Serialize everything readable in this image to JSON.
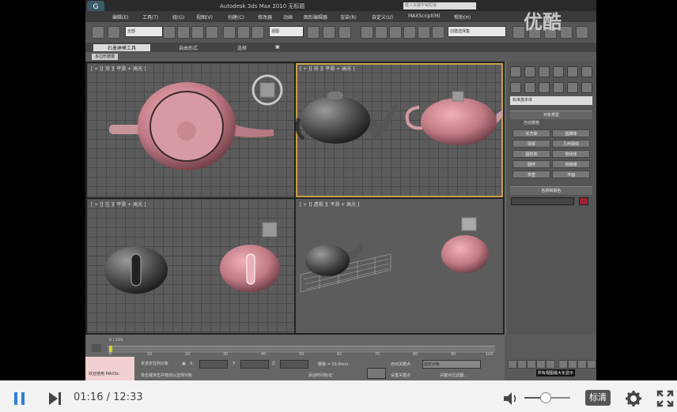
{
  "player": {
    "current_time": "01:16",
    "separator": "/",
    "duration": "12:33",
    "progress_fraction": 0.101,
    "volume_fraction": 0.45,
    "quality_label": "标清",
    "watermark_text": "优酷"
  },
  "app": {
    "title": "Autodesk 3ds Max 2010   无标题",
    "search_placeholder": "键入关键字或短语",
    "menus": [
      "编辑(E)",
      "工具(T)",
      "组(G)",
      "视图(V)",
      "创建(C)",
      "修改器",
      "动画",
      "图形编辑器",
      "渲染(R)",
      "自定义(U)",
      "MAXScript(M)",
      "帮助(H)"
    ],
    "toolbar_select_all": "全部",
    "toolbar_select_view": "视图",
    "toolbar_select_named": "创建选择集",
    "ribbon_tabs": [
      "石墨建模工具",
      "自由形式",
      "选择",
      "▣"
    ],
    "ribbon_chip": "多边形建模",
    "viewports": [
      {
        "label": "[ + ][ 顶 ][ 平滑 + 高光 ]"
      },
      {
        "label": "[ + ][ 前 ][ 平滑 + 高光 ]"
      },
      {
        "label": "[ + ][ 左 ][ 平滑 + 高光 ]"
      },
      {
        "label": "[ + ][ 透视 ][ 平滑 + 高光 ]"
      }
    ],
    "command_panel": {
      "dropdown": "标准基本体",
      "section_object_type": "对象类型",
      "autogrid": "自动栅格",
      "buttons": [
        "长方体",
        "圆锥体",
        "球体",
        "几何球体",
        "圆柱体",
        "管状体",
        "圆环",
        "四棱锥",
        "茶壶",
        "平面"
      ],
      "section_name_color": "名称和颜色"
    },
    "timeline": {
      "frame_counter": "0 / 100",
      "ticks": [
        "0",
        "10",
        "20",
        "30",
        "40",
        "50",
        "60",
        "70",
        "80",
        "90",
        "100"
      ]
    },
    "status": {
      "maxscript_label": "欢迎使用 MAXSc",
      "selection_status": "未选定任何对象",
      "prompt": "单击或单击并拖动以选择对象",
      "x_label": "X:",
      "y_label": "Y:",
      "z_label": "Z:",
      "grid_label": "栅格 = 10.0mm",
      "auto_key": "自动关键点",
      "set_key": "设置关键点",
      "selected_object": "选定对象",
      "key_filters": "关键点过滤器...",
      "add_time_tag": "添加时间标记",
      "tooltip": "所有视图最大化显示"
    }
  }
}
